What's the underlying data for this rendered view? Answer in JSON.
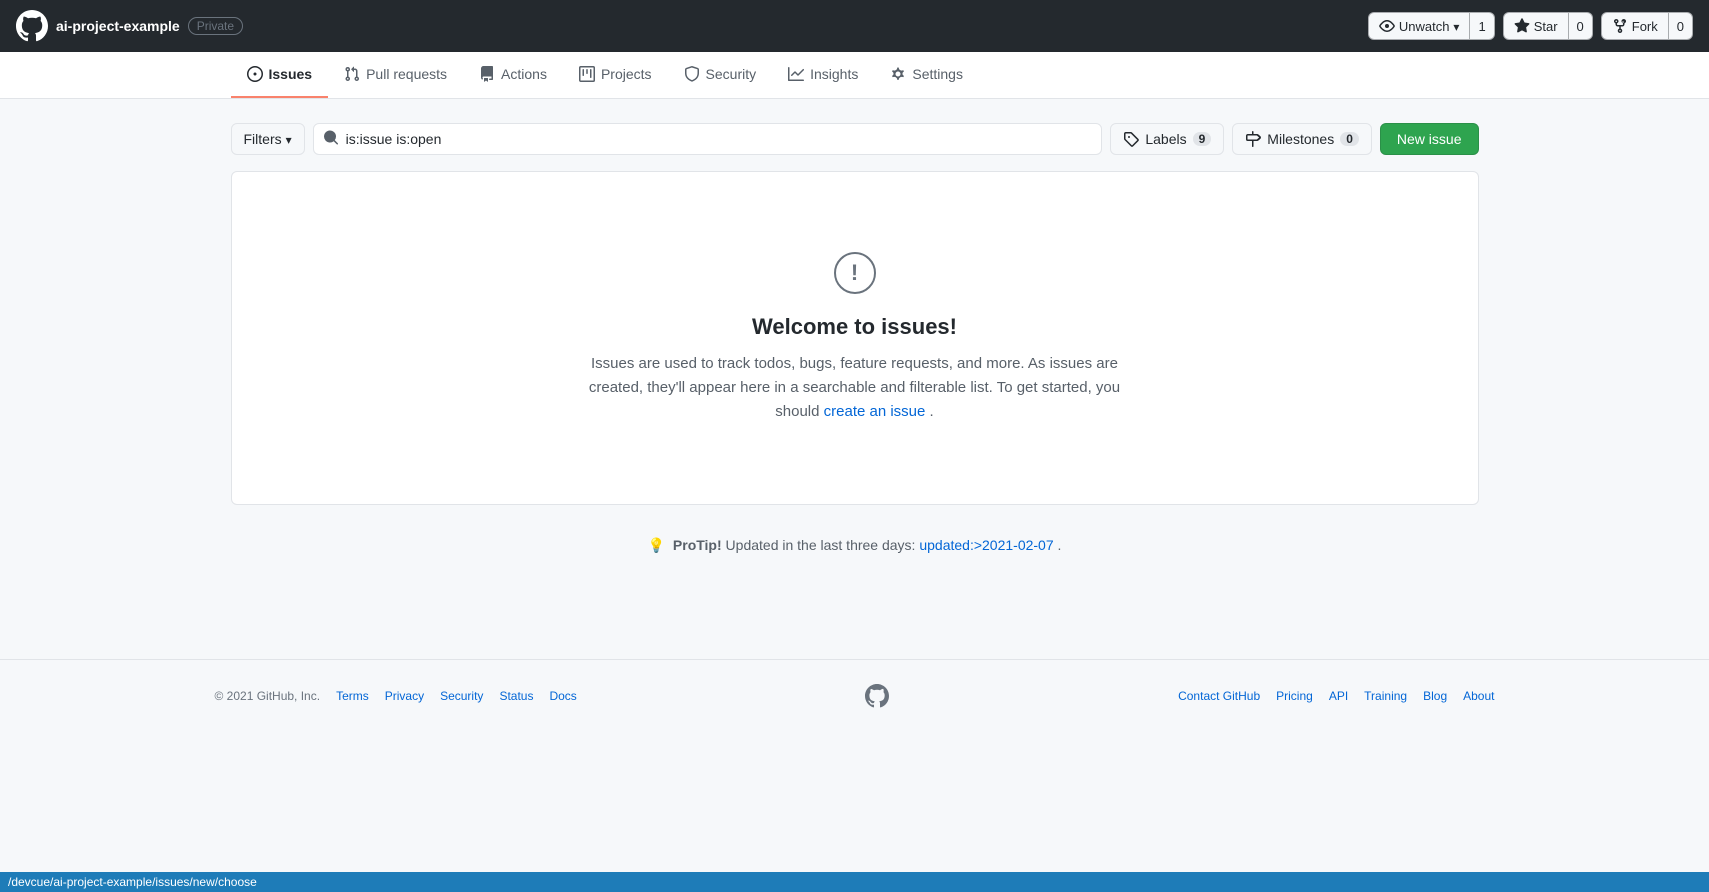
{
  "topbar": {
    "repo_owner": "ai-project-example",
    "slash": "/",
    "privacy_label": "Private",
    "unwatch_label": "Unwatch",
    "unwatch_count": "1",
    "star_label": "Star",
    "star_count": "0",
    "fork_label": "Fork",
    "fork_count": "0"
  },
  "nav": {
    "tabs": [
      {
        "id": "issues",
        "label": "Issues",
        "icon": "issues-icon",
        "active": true
      },
      {
        "id": "pull-requests",
        "label": "Pull requests",
        "icon": "pr-icon",
        "active": false
      },
      {
        "id": "actions",
        "label": "Actions",
        "icon": "actions-icon",
        "active": false
      },
      {
        "id": "projects",
        "label": "Projects",
        "icon": "projects-icon",
        "active": false
      },
      {
        "id": "security",
        "label": "Security",
        "icon": "security-icon",
        "active": false
      },
      {
        "id": "insights",
        "label": "Insights",
        "icon": "insights-icon",
        "active": false
      },
      {
        "id": "settings",
        "label": "Settings",
        "icon": "settings-icon",
        "active": false
      }
    ]
  },
  "filterbar": {
    "filter_label": "Filters",
    "search_value": "is:issue is:open",
    "search_placeholder": "is:issue is:open",
    "labels_label": "Labels",
    "labels_count": "9",
    "milestones_label": "Milestones",
    "milestones_count": "0",
    "new_issue_label": "New issue"
  },
  "empty_state": {
    "title": "Welcome to issues!",
    "description_before": "Issues are used to track todos, bugs, feature requests, and more. As issues are created, they'll appear here in a searchable and filterable list. To get started, you should ",
    "link_text": "create an issue",
    "description_after": "."
  },
  "protip": {
    "text_before": "ProTip!",
    "text_middle": " Updated in the last three days: ",
    "link_text": "updated:>2021-02-07",
    "text_after": "."
  },
  "footer": {
    "copyright": "© 2021 GitHub, Inc.",
    "links": [
      {
        "label": "Terms"
      },
      {
        "label": "Privacy"
      },
      {
        "label": "Security"
      },
      {
        "label": "Status"
      },
      {
        "label": "Docs"
      },
      {
        "label": "Contact GitHub"
      },
      {
        "label": "Pricing"
      },
      {
        "label": "API"
      },
      {
        "label": "Training"
      },
      {
        "label": "Blog"
      },
      {
        "label": "About"
      }
    ]
  },
  "statusbar": {
    "url": "/devcue/ai-project-example/issues/new/choose"
  }
}
